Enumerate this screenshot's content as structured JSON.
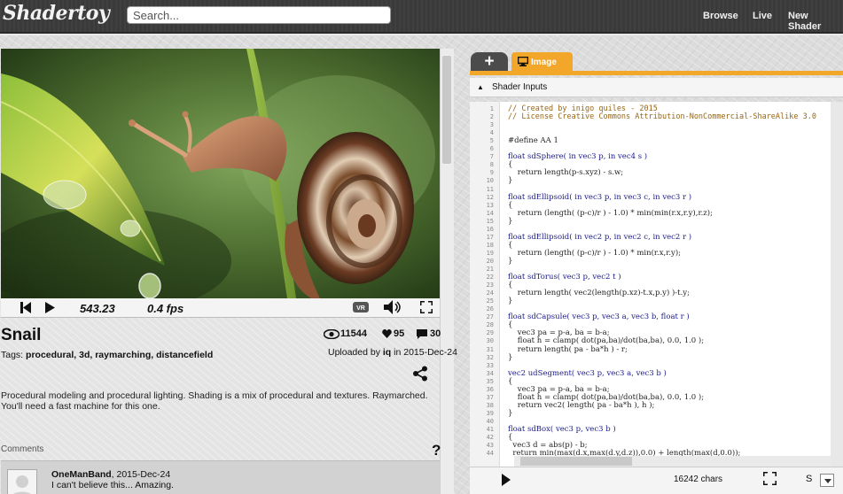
{
  "header": {
    "logo": "Shadertoy",
    "search_placeholder": "Search...",
    "nav": [
      "Browse",
      "Live",
      "New Shader"
    ]
  },
  "player": {
    "time": "543.23",
    "fps": "0.4 fps",
    "vr_label": "VR"
  },
  "shader": {
    "title": "Snail",
    "views": "11544",
    "likes": "95",
    "comments_count": "30",
    "tags_label": "Tags:",
    "tags": "procedural, 3d, raymarching, distancefield",
    "uploaded_prefix": "Uploaded by",
    "author": "iq",
    "uploaded_suffix": "in 2015-Dec-24",
    "description": "Procedural modeling and procedural lighting. Shading is a mix of procedural and textures. Raymarched. You'll need a fast machine for this one."
  },
  "comments": {
    "heading": "Comments",
    "help": "?",
    "items": [
      {
        "author": "OneManBand",
        "date": ", 2015-Dec-24",
        "text": "I can't believe this... Amazing."
      }
    ]
  },
  "editor": {
    "tab_add": "+",
    "tab_image": "Image",
    "inputs_label": "Shader Inputs",
    "chars": "16242 chars",
    "font_size": "S",
    "lines": [
      {
        "n": "1",
        "t": "// Created by inigo quiles - 2015",
        "c": "comment"
      },
      {
        "n": "2",
        "t": "// License Creative Commons Attribution-NonCommercial-ShareAlike 3.0",
        "c": "comment"
      },
      {
        "n": "3",
        "t": "",
        "c": ""
      },
      {
        "n": "4",
        "t": "",
        "c": ""
      },
      {
        "n": "5",
        "t": "#define AA 1",
        "c": ""
      },
      {
        "n": "6",
        "t": "",
        "c": ""
      },
      {
        "n": "7",
        "t": "float sdSphere( in vec3 p, in vec4 s )",
        "c": "kw"
      },
      {
        "n": "8",
        "t": "{",
        "c": ""
      },
      {
        "n": "9",
        "t": "    return length(p-s.xyz) - s.w;",
        "c": ""
      },
      {
        "n": "10",
        "t": "}",
        "c": ""
      },
      {
        "n": "11",
        "t": "",
        "c": ""
      },
      {
        "n": "12",
        "t": "float sdEllipsoid( in vec3 p, in vec3 c, in vec3 r )",
        "c": "kw"
      },
      {
        "n": "13",
        "t": "{",
        "c": ""
      },
      {
        "n": "14",
        "t": "    return (length( (p-c)/r ) - 1.0) * min(min(r.x,r.y),r.z);",
        "c": ""
      },
      {
        "n": "15",
        "t": "}",
        "c": ""
      },
      {
        "n": "16",
        "t": "",
        "c": ""
      },
      {
        "n": "17",
        "t": "float sdEllipsoid( in vec2 p, in vec2 c, in vec2 r )",
        "c": "kw"
      },
      {
        "n": "18",
        "t": "{",
        "c": ""
      },
      {
        "n": "19",
        "t": "    return (length( (p-c)/r ) - 1.0) * min(r.x,r.y);",
        "c": ""
      },
      {
        "n": "20",
        "t": "}",
        "c": ""
      },
      {
        "n": "21",
        "t": "",
        "c": ""
      },
      {
        "n": "22",
        "t": "float sdTorus( vec3 p, vec2 t )",
        "c": "kw"
      },
      {
        "n": "23",
        "t": "{",
        "c": ""
      },
      {
        "n": "24",
        "t": "    return length( vec2(length(p.xz)-t.x,p.y) )-t.y;",
        "c": ""
      },
      {
        "n": "25",
        "t": "}",
        "c": ""
      },
      {
        "n": "26",
        "t": "",
        "c": ""
      },
      {
        "n": "27",
        "t": "float sdCapsule( vec3 p, vec3 a, vec3 b, float r )",
        "c": "kw"
      },
      {
        "n": "28",
        "t": "{",
        "c": ""
      },
      {
        "n": "29",
        "t": "    vec3 pa = p-a, ba = b-a;",
        "c": ""
      },
      {
        "n": "30",
        "t": "    float h = clamp( dot(pa,ba)/dot(ba,ba), 0.0, 1.0 );",
        "c": ""
      },
      {
        "n": "31",
        "t": "    return length( pa - ba*h ) - r;",
        "c": ""
      },
      {
        "n": "32",
        "t": "}",
        "c": ""
      },
      {
        "n": "33",
        "t": "",
        "c": ""
      },
      {
        "n": "34",
        "t": "vec2 udSegment( vec3 p, vec3 a, vec3 b )",
        "c": "kw"
      },
      {
        "n": "35",
        "t": "{",
        "c": ""
      },
      {
        "n": "36",
        "t": "    vec3 pa = p-a, ba = b-a;",
        "c": ""
      },
      {
        "n": "37",
        "t": "    float h = clamp( dot(pa,ba)/dot(ba,ba), 0.0, 1.0 );",
        "c": ""
      },
      {
        "n": "38",
        "t": "    return vec2( length( pa - ba*h ), h );",
        "c": ""
      },
      {
        "n": "39",
        "t": "}",
        "c": ""
      },
      {
        "n": "40",
        "t": "",
        "c": ""
      },
      {
        "n": "41",
        "t": "float sdBox( vec3 p, vec3 b )",
        "c": "kw"
      },
      {
        "n": "42",
        "t": "{",
        "c": ""
      },
      {
        "n": "43",
        "t": "  vec3 d = abs(p) - b;",
        "c": ""
      },
      {
        "n": "44",
        "t": "  return min(max(d.x,max(d.y,d.z)),0.0) + length(max(d,0.0));",
        "c": ""
      }
    ]
  },
  "colors": {
    "accent": "#f2a62a",
    "topbar": "#3a3a3a"
  }
}
